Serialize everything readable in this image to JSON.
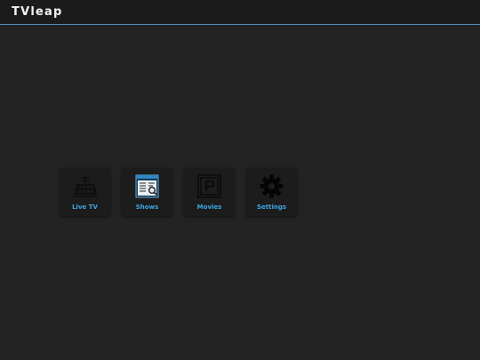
{
  "app": {
    "title": "TVleap"
  },
  "menu": {
    "items": [
      {
        "label": "Live TV",
        "icon": "antenna-tower-icon"
      },
      {
        "label": "Shows",
        "icon": "tv-guide-icon"
      },
      {
        "label": "Movies",
        "icon": "parking-sign-icon"
      },
      {
        "label": "Settings",
        "icon": "gear-icon"
      }
    ]
  },
  "colors": {
    "background": "#232323",
    "topbar": "#1b1b1b",
    "accent_line": "#4a8fbf",
    "label_blue": "#3ea6e6"
  }
}
